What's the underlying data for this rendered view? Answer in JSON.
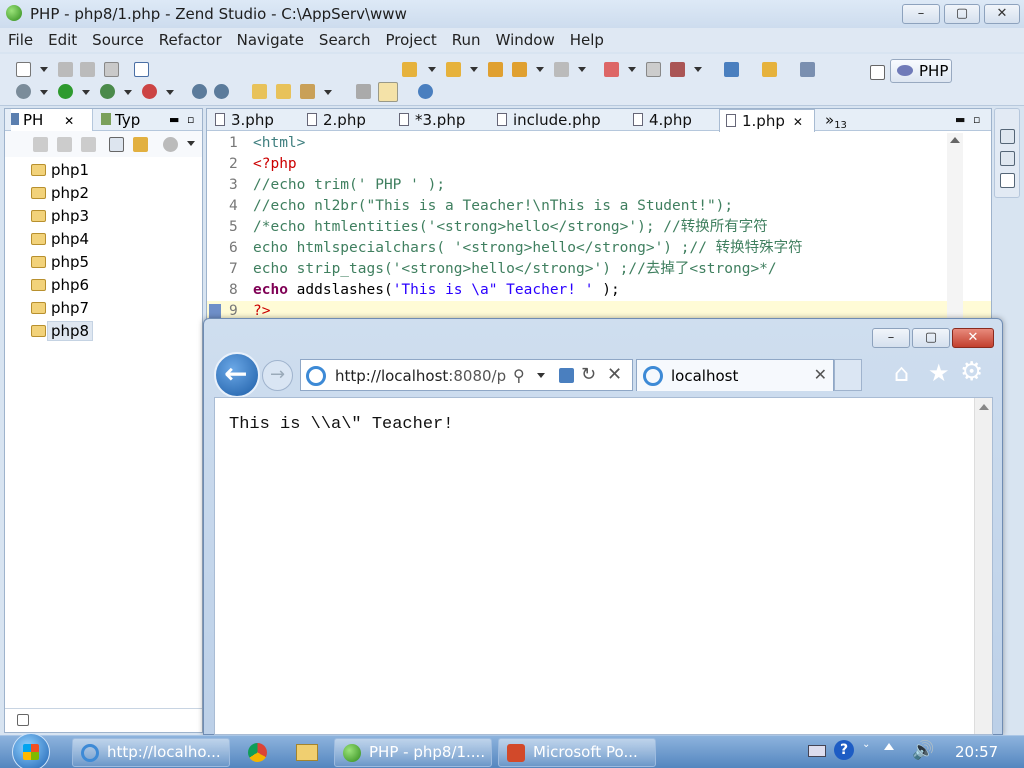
{
  "window": {
    "title": "PHP - php8/1.php - Zend Studio - C:\\AppServ\\www",
    "minimize": "–",
    "maximize": "▢",
    "close": "✕"
  },
  "menu": [
    "File",
    "Edit",
    "Source",
    "Refactor",
    "Navigate",
    "Search",
    "Project",
    "Run",
    "Window",
    "Help"
  ],
  "perspective": {
    "label": "PHP"
  },
  "left_panel": {
    "tabs": [
      {
        "label": "PH",
        "close": "✕"
      },
      {
        "label": "Typ"
      }
    ],
    "items": [
      "php1",
      "php2",
      "php3",
      "php4",
      "php5",
      "php6",
      "php7",
      "php8"
    ],
    "selected": "php8"
  },
  "editor": {
    "tabs": [
      {
        "label": "3.php"
      },
      {
        "label": "2.php"
      },
      {
        "label": "*3.php"
      },
      {
        "label": "include.php"
      },
      {
        "label": "4.php"
      },
      {
        "label": "1.php",
        "close": "✕"
      }
    ],
    "overflow": "»",
    "overflow_count": "13",
    "lines": [
      {
        "num": "1",
        "parts": [
          {
            "t": "<html>",
            "c": "c-tag"
          }
        ]
      },
      {
        "num": "2",
        "parts": [
          {
            "t": "<?php",
            "c": "c-php"
          }
        ]
      },
      {
        "num": "3",
        "parts": [
          {
            "t": "//echo trim(' PHP ' );",
            "c": "c-cmt"
          }
        ]
      },
      {
        "num": "4",
        "parts": [
          {
            "t": "//echo nl2br(\"This is a Teacher!\\nThis is a Student!\");",
            "c": "c-cmt"
          }
        ]
      },
      {
        "num": "5",
        "parts": [
          {
            "t": "/*echo htmlentities('<strong>hello</strong>'); //转换所有字符",
            "c": "c-cmt"
          }
        ]
      },
      {
        "num": "6",
        "parts": [
          {
            "t": "echo htmlspecialchars( '<strong>hello</strong>') ;// 转换特殊字符",
            "c": "c-cmt"
          }
        ]
      },
      {
        "num": "7",
        "parts": [
          {
            "t": "echo strip_tags('<strong>hello</strong>') ;//去掉了<strong>*/",
            "c": "c-cmt"
          }
        ]
      },
      {
        "num": "8",
        "parts": [
          {
            "t": "echo",
            "c": "c-kw"
          },
          {
            "t": " addslashes(",
            "c": ""
          },
          {
            "t": "'This is \\a\" Teacher! '",
            "c": "c-str"
          },
          {
            "t": " );",
            "c": ""
          }
        ]
      },
      {
        "num": "9",
        "parts": [
          {
            "t": "?>",
            "c": "c-php"
          }
        ]
      }
    ]
  },
  "browser": {
    "address": "http://localhost:8080/p",
    "address_host": "http://localhost",
    "address_rest": ":8080/p",
    "tab_title": "localhost",
    "tab_close": "✕",
    "page_text": "This is \\\\a\\\" Teacher!"
  },
  "taskbar": {
    "items": [
      {
        "label": "http://localho..."
      },
      {
        "label": "PHP - php8/1...."
      },
      {
        "label": "Microsoft Po..."
      }
    ],
    "clock": "20:57"
  }
}
